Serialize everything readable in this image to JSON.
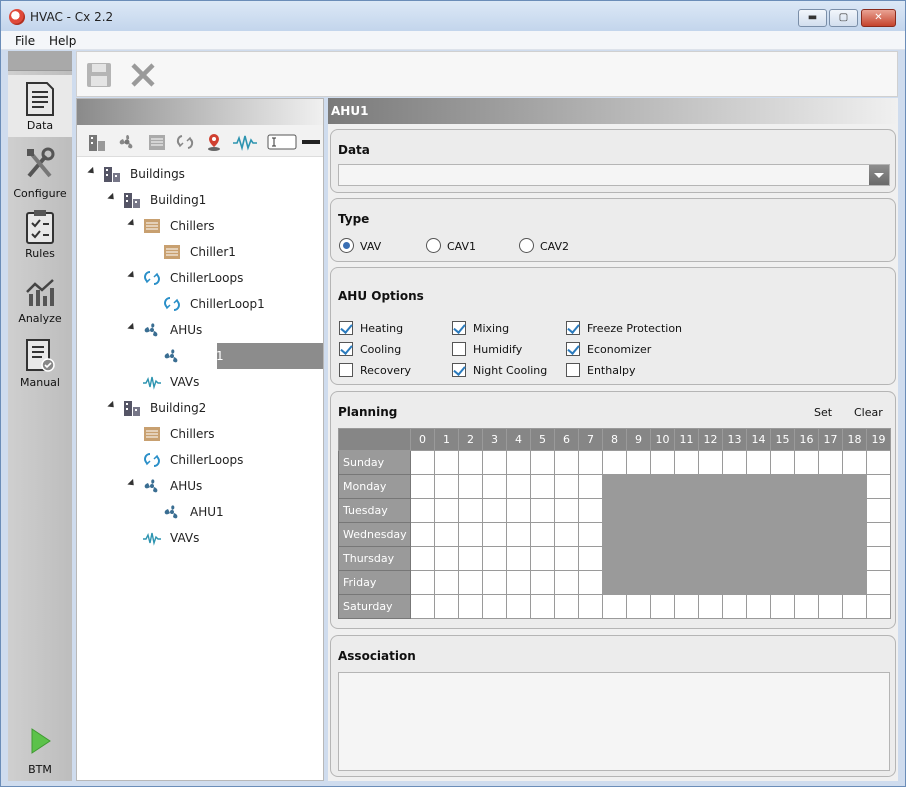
{
  "window": {
    "title": "HVAC - Cx 2.2",
    "min_glyph": "▬",
    "max_glyph": "▢",
    "close_glyph": "✕"
  },
  "menu": [
    "File",
    "Help"
  ],
  "nav": [
    {
      "label": "Data",
      "icon": "data-document-icon",
      "active": true
    },
    {
      "label": "Configure",
      "icon": "tools-icon",
      "active": false
    },
    {
      "label": "Rules",
      "icon": "checklist-icon",
      "active": false
    },
    {
      "label": "Analyze",
      "icon": "analyze-chart-icon",
      "active": false
    },
    {
      "label": "Manual",
      "icon": "manual-icon",
      "active": false
    },
    {
      "label": "BTM",
      "icon": "play-icon",
      "active": false
    }
  ],
  "toolbar": {
    "save_icon": "save-icon",
    "close_icon": "close-icon"
  },
  "tree_tools": [
    "buildings-icon",
    "fan-icon",
    "chiller-icon",
    "loop-icon",
    "location-pin-icon",
    "wave-icon",
    "text-field-icon",
    "minus-icon"
  ],
  "tree": [
    {
      "label": "Buildings",
      "level": 0,
      "expanded": true,
      "icon": "buildings-icon"
    },
    {
      "label": "Building1",
      "level": 1,
      "expanded": true,
      "icon": "buildings-icon"
    },
    {
      "label": "Chillers",
      "level": 2,
      "expanded": true,
      "icon": "chiller-icon"
    },
    {
      "label": "Chiller1",
      "level": 3,
      "expanded": null,
      "icon": "chiller-icon"
    },
    {
      "label": "ChillerLoops",
      "level": 2,
      "expanded": true,
      "icon": "loop-icon"
    },
    {
      "label": "ChillerLoop1",
      "level": 3,
      "expanded": null,
      "icon": "loop-icon"
    },
    {
      "label": "AHUs",
      "level": 2,
      "expanded": true,
      "icon": "fan-icon"
    },
    {
      "label": "AHU1",
      "level": 3,
      "expanded": null,
      "icon": "fan-icon",
      "selected": true
    },
    {
      "label": "VAVs",
      "level": 2,
      "expanded": null,
      "icon": "wave-icon"
    },
    {
      "label": "Building2",
      "level": 1,
      "expanded": true,
      "icon": "buildings-icon"
    },
    {
      "label": "Chillers",
      "level": 2,
      "expanded": null,
      "icon": "chiller-icon"
    },
    {
      "label": "ChillerLoops",
      "level": 2,
      "expanded": null,
      "icon": "loop-icon"
    },
    {
      "label": "AHUs",
      "level": 2,
      "expanded": true,
      "icon": "fan-icon"
    },
    {
      "label": "AHU1",
      "level": 3,
      "expanded": null,
      "icon": "fan-icon"
    },
    {
      "label": "VAVs",
      "level": 2,
      "expanded": null,
      "icon": "wave-icon"
    }
  ],
  "main": {
    "title": "AHU1",
    "data_group": {
      "title": "Data",
      "value": ""
    },
    "type_group": {
      "title": "Type",
      "options": [
        {
          "label": "VAV",
          "checked": true
        },
        {
          "label": "CAV1",
          "checked": false
        },
        {
          "label": "CAV2",
          "checked": false
        }
      ]
    },
    "options_group": {
      "title": "AHU Options",
      "options": [
        {
          "label": "Heating",
          "checked": true
        },
        {
          "label": "Cooling",
          "checked": true
        },
        {
          "label": "Recovery",
          "checked": false
        },
        {
          "label": "Mixing",
          "checked": true
        },
        {
          "label": "Humidify",
          "checked": false
        },
        {
          "label": "Night Cooling",
          "checked": true
        },
        {
          "label": "Freeze Protection",
          "checked": true
        },
        {
          "label": "Economizer",
          "checked": true
        },
        {
          "label": "Enthalpy",
          "checked": false
        }
      ]
    },
    "planning": {
      "title": "Planning",
      "set_label": "Set",
      "clear_label": "Clear",
      "hours": [
        "0",
        "1",
        "2",
        "3",
        "4",
        "5",
        "6",
        "7",
        "8",
        "9",
        "10",
        "11",
        "12",
        "13",
        "14",
        "15",
        "16",
        "17",
        "18",
        "19"
      ],
      "days": [
        {
          "name": "Sunday",
          "on": []
        },
        {
          "name": "Monday",
          "on": [
            8,
            9,
            10,
            11,
            12,
            13,
            14,
            15,
            16,
            17,
            18
          ]
        },
        {
          "name": "Tuesday",
          "on": [
            8,
            9,
            10,
            11,
            12,
            13,
            14,
            15,
            16,
            17,
            18
          ]
        },
        {
          "name": "Wednesday",
          "on": [
            8,
            9,
            10,
            11,
            12,
            13,
            14,
            15,
            16,
            17,
            18
          ]
        },
        {
          "name": "Thursday",
          "on": [
            8,
            9,
            10,
            11,
            12,
            13,
            14,
            15,
            16,
            17,
            18
          ]
        },
        {
          "name": "Friday",
          "on": [
            8,
            9,
            10,
            11,
            12,
            13,
            14,
            15,
            16,
            17,
            18
          ]
        },
        {
          "name": "Saturday",
          "on": []
        }
      ]
    },
    "association": {
      "title": "Association"
    }
  }
}
